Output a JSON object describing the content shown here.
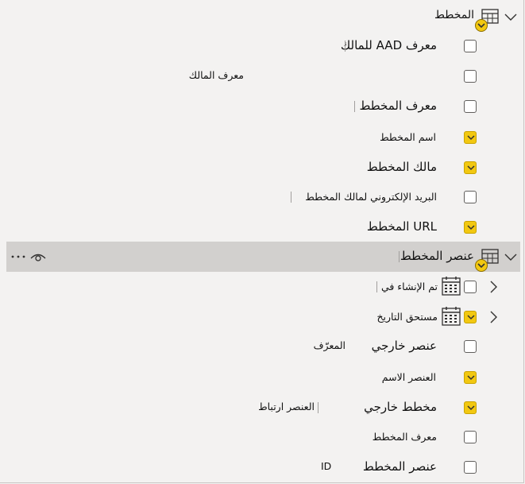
{
  "groups": [
    {
      "label": "المخطط",
      "icon": "table-icon",
      "fields": [
        {
          "label": "معرف AAD للمالك",
          "checked": false,
          "sub": ""
        },
        {
          "label": "",
          "checked": false,
          "sub": "معرف المالك"
        },
        {
          "label": "معرف المخطط",
          "checked": false,
          "sub": ""
        },
        {
          "label": "اسم المخطط",
          "checked": true,
          "sub": ""
        },
        {
          "label": "مالك المخطط",
          "checked": true,
          "sub": ""
        },
        {
          "label": "البريد الإلكتروني لمالك المخطط",
          "checked": false,
          "sub": ""
        },
        {
          "label": "URL المخطط",
          "checked": true,
          "sub": ""
        }
      ]
    },
    {
      "label": "عنصر المخطط",
      "icon": "table-icon",
      "selected": true,
      "fields": [
        {
          "label": "تم الإنشاء في",
          "checked": false,
          "sub": "",
          "expandable": true,
          "icon": "calendar-icon"
        },
        {
          "label": "مستحق التاريخ",
          "checked": true,
          "sub": "",
          "expandable": true,
          "icon": "calendar-icon"
        },
        {
          "label": "عنصر خارجي",
          "checked": false,
          "sub": "المعرّف"
        },
        {
          "label": "العنصر الاسم",
          "checked": true,
          "sub": ""
        },
        {
          "label": "مخطط خارجي",
          "checked": true,
          "sub": "العنصر ارتباط"
        },
        {
          "label": "معرف المخطط",
          "checked": false,
          "sub": ""
        },
        {
          "label": "عنصر المخطط",
          "checked": false,
          "sub": "ID"
        }
      ]
    }
  ],
  "colors": {
    "accent": "#f2c811",
    "selected_row": "#d2d0ce",
    "background": "#f3f2f1"
  }
}
